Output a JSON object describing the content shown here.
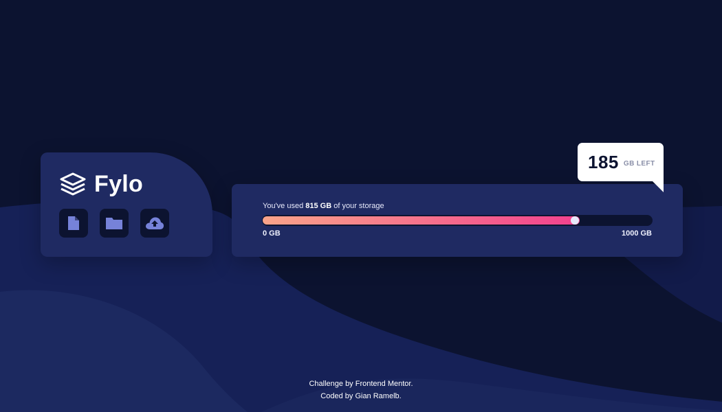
{
  "brand": {
    "name": "Fylo",
    "logo_icon": "stacked-layers-icon"
  },
  "actions": [
    {
      "icon": "document-icon",
      "color": "#7682d9"
    },
    {
      "icon": "folder-icon",
      "color": "#7682d9"
    },
    {
      "icon": "cloud-upload-icon",
      "color": "#7682d9"
    }
  ],
  "storage": {
    "used_prefix": "You've used",
    "used_value": "815 GB",
    "used_suffix": "of your storage",
    "used_fraction": 0.815,
    "min_label": "0 GB",
    "max_label": "1000 GB",
    "remaining_value": "185",
    "remaining_unit": "GB LEFT",
    "gradient_start": "#f9a48a",
    "gradient_end": "#f2418e"
  },
  "footer": {
    "line1_prefix": "Challenge by",
    "line1_link": "Frontend Mentor",
    "line1_suffix": ".",
    "line2_prefix": "Coded by",
    "line2_link": "Gian Ramelb",
    "line2_suffix": "."
  },
  "colors": {
    "background": "#0c1330",
    "card": "#1f2a62",
    "icon_tile": "#0c1330"
  }
}
